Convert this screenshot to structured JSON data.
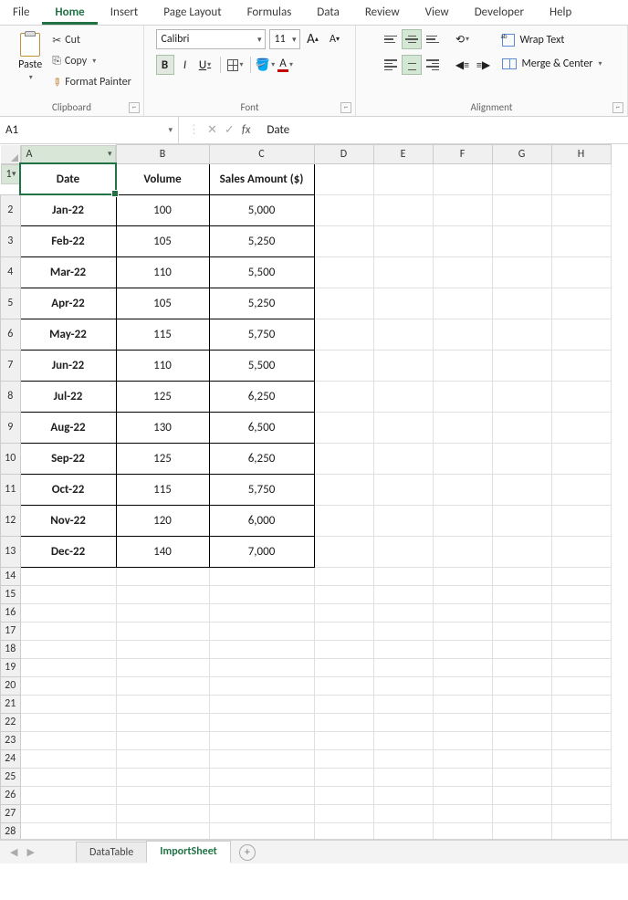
{
  "ribbon_tabs": {
    "file": "File",
    "home": "Home",
    "insert": "Insert",
    "pagelayout": "Page Layout",
    "formulas": "Formulas",
    "data": "Data",
    "review": "Review",
    "view": "View",
    "developer": "Developer",
    "help": "Help"
  },
  "clipboard": {
    "paste": "Paste",
    "cut": "Cut",
    "copy": "Copy",
    "format_painter": "Format Painter",
    "group": "Clipboard"
  },
  "font": {
    "name": "Calibri",
    "size": "11",
    "group": "Font",
    "bold": "B",
    "italic": "I",
    "underline": "U",
    "incA": "A",
    "decA": "A",
    "fontA": "A"
  },
  "alignment": {
    "wrap": "Wrap Text",
    "merge": "Merge & Center",
    "group": "Alignment"
  },
  "namebox": "A1",
  "formula_value": "Date",
  "columns": [
    "A",
    "B",
    "C",
    "D",
    "E",
    "F",
    "G",
    "H"
  ],
  "row_count_visible": 29,
  "headers": {
    "A": "Date",
    "B": "Volume",
    "C": "Sales Amount ($)"
  },
  "rows": [
    {
      "date": "Jan-22",
      "vol": "100",
      "amt": "5,000"
    },
    {
      "date": "Feb-22",
      "vol": "105",
      "amt": "5,250"
    },
    {
      "date": "Mar-22",
      "vol": "110",
      "amt": "5,500"
    },
    {
      "date": "Apr-22",
      "vol": "105",
      "amt": "5,250"
    },
    {
      "date": "May-22",
      "vol": "115",
      "amt": "5,750"
    },
    {
      "date": "Jun-22",
      "vol": "110",
      "amt": "5,500"
    },
    {
      "date": "Jul-22",
      "vol": "125",
      "amt": "6,250"
    },
    {
      "date": "Aug-22",
      "vol": "130",
      "amt": "6,500"
    },
    {
      "date": "Sep-22",
      "vol": "125",
      "amt": "6,250"
    },
    {
      "date": "Oct-22",
      "vol": "115",
      "amt": "5,750"
    },
    {
      "date": "Nov-22",
      "vol": "120",
      "amt": "6,000"
    },
    {
      "date": "Dec-22",
      "vol": "140",
      "amt": "7,000"
    }
  ],
  "sheets": {
    "s1": "DataTable",
    "s2": "ImportSheet"
  }
}
